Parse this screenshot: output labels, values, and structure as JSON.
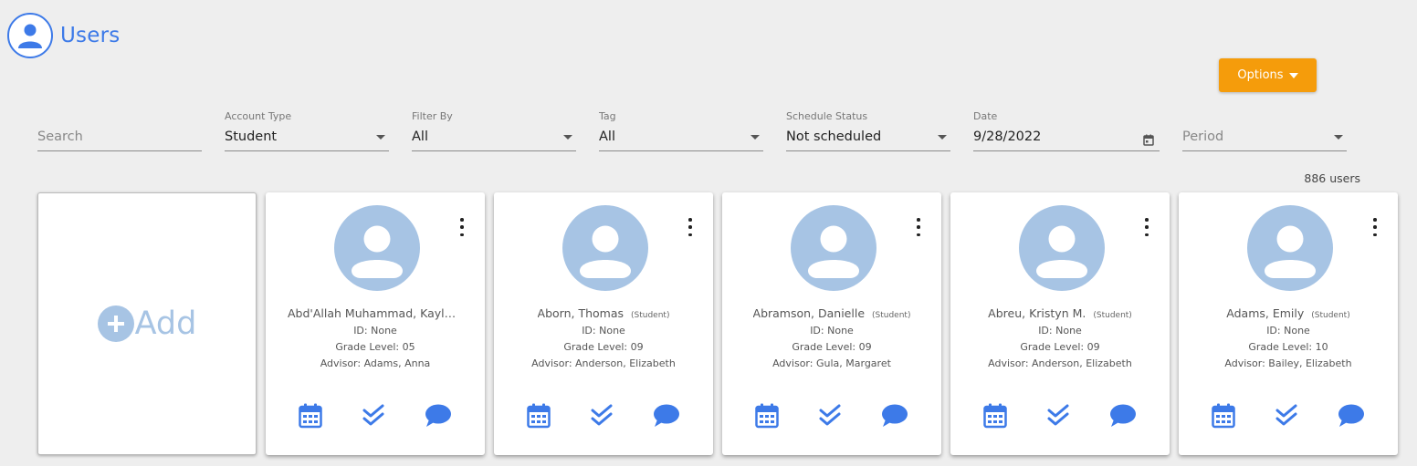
{
  "header": {
    "title": "Users",
    "icon": "user-circle-icon"
  },
  "options": {
    "label": "Options"
  },
  "filters": {
    "search": {
      "placeholder": "Search"
    },
    "account_type": {
      "label": "Account Type",
      "value": "Student"
    },
    "filter_by": {
      "label": "Filter By",
      "value": "All"
    },
    "tag": {
      "label": "Tag",
      "value": "All"
    },
    "schedule_status": {
      "label": "Schedule Status",
      "value": "Not scheduled"
    },
    "date": {
      "label": "Date",
      "value": "9/28/2022"
    },
    "period": {
      "placeholder": "Period"
    }
  },
  "user_count": "886 users",
  "add_card": {
    "label": "Add"
  },
  "colors": {
    "accent": "#3d7ae8",
    "options": "#f59c0b",
    "avatar": "#a7c4e4"
  },
  "users": [
    {
      "name": "Abd'Allah Muhammad, Kayl…",
      "type": "",
      "id": "ID: None",
      "grade": "Grade Level: 05",
      "advisor": "Advisor: Adams, Anna"
    },
    {
      "name": "Aborn, Thomas",
      "type": "(Student)",
      "id": "ID: None",
      "grade": "Grade Level: 09",
      "advisor": "Advisor: Anderson, Elizabeth"
    },
    {
      "name": "Abramson, Danielle",
      "type": "(Student)",
      "id": "ID: None",
      "grade": "Grade Level: 09",
      "advisor": "Advisor: Gula, Margaret"
    },
    {
      "name": "Abreu, Kristyn M.",
      "type": "(Student)",
      "id": "ID: None",
      "grade": "Grade Level: 09",
      "advisor": "Advisor: Anderson, Elizabeth"
    },
    {
      "name": "Adams, Emily",
      "type": "(Student)",
      "id": "ID: None",
      "grade": "Grade Level: 10",
      "advisor": "Advisor: Bailey, Elizabeth"
    }
  ]
}
